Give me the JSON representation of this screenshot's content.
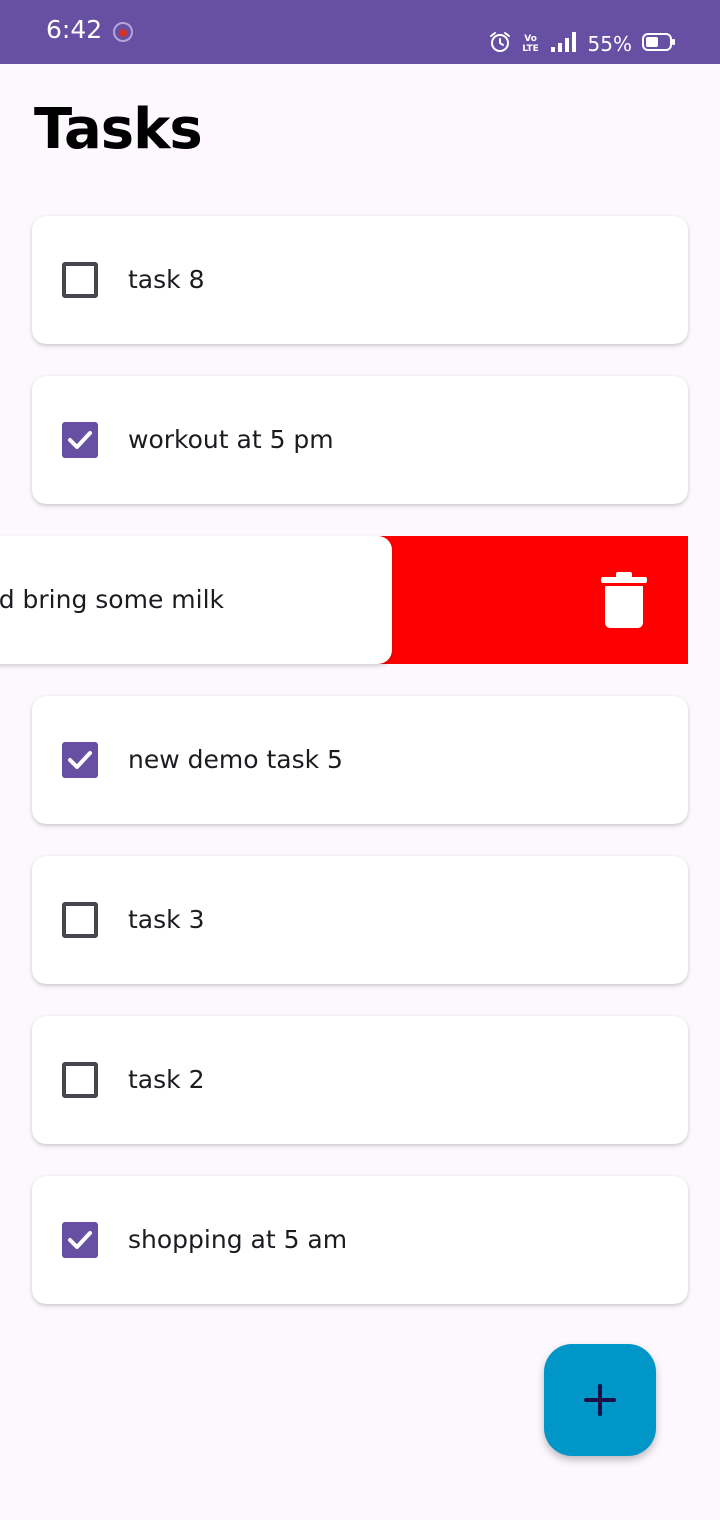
{
  "status_bar": {
    "time": "6:42",
    "battery_percent": "55%",
    "volte_text": "Vo LTE",
    "icons": [
      "recording-indicator-icon",
      "alarm-icon",
      "volte-icon",
      "signal-icon",
      "battery-icon"
    ],
    "background_color": "#6750A4"
  },
  "page": {
    "title": "Tasks"
  },
  "tasks": [
    {
      "label": "task 8",
      "checked": false
    },
    {
      "label": "workout at 5 pm",
      "checked": true
    },
    {
      "label": "und bring some milk",
      "checked": null,
      "swiped": true
    },
    {
      "label": "new demo task 5",
      "checked": true
    },
    {
      "label": "task 3",
      "checked": false
    },
    {
      "label": "task 2",
      "checked": false
    },
    {
      "label": "shopping at 5 am",
      "checked": true
    }
  ],
  "swipe_action": {
    "icon": "trash-icon",
    "color": "#FF0000"
  },
  "fab": {
    "icon": "plus-icon",
    "color": "#0096C7"
  },
  "colors": {
    "accent": "#6750A4",
    "background": "#FDF7FE",
    "delete": "#FF0000",
    "fab": "#0096C7"
  }
}
